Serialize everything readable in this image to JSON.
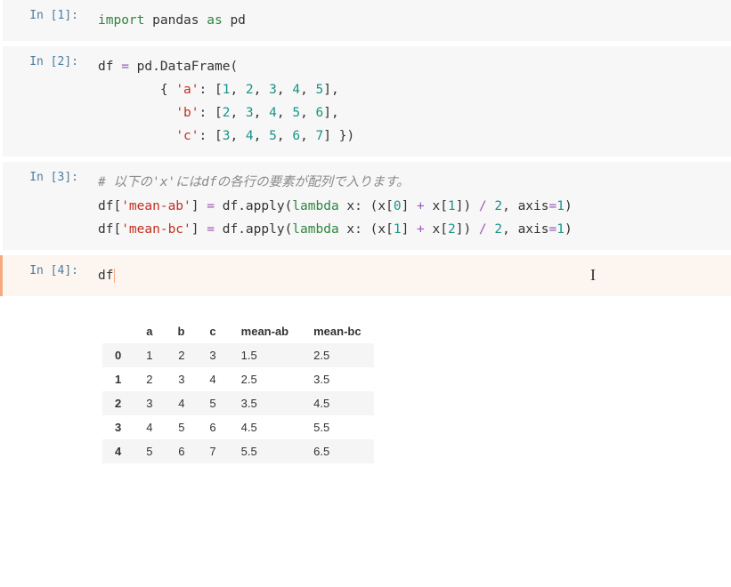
{
  "cells": {
    "c1": {
      "prompt": "In [1]:",
      "tok": {
        "import": "import",
        "pandas": "pandas",
        "as": "as",
        "pd": "pd"
      }
    },
    "c2": {
      "prompt": "In [2]:",
      "tok": {
        "df": "df",
        "eq": "=",
        "pdDataFrame": "pd.DataFrame(",
        "lbrace": "{",
        "a": "'a'",
        "colon": ":",
        "lb": "[",
        "rb": "]",
        "b": "'b'",
        "c": "'c'",
        "n1": "1",
        "n2": "2",
        "n3": "3",
        "n4": "4",
        "n5": "5",
        "n6": "6",
        "n7": "7",
        "comma": ",",
        "rbrace": "}",
        "rparen": ")"
      }
    },
    "c3": {
      "prompt": "In [3]:",
      "tok": {
        "comment_pre": "# 以下の",
        "comment_x": "'x'",
        "comment_mid": "には",
        "comment_df": "df",
        "comment_post": "の各行の要素が配列で入ります。",
        "df": "df",
        "lb": "[",
        "rb": "]",
        "meanab": "'mean-ab'",
        "meanbc": "'mean-bc'",
        "eq": "=",
        "apply": ".apply(",
        "lambda": "lambda",
        "x": "x",
        "colon": ":",
        "lp": "(",
        "rp": ")",
        "x0": "x[",
        "x1e": "]",
        "plus": "+",
        "div": "/",
        "n0": "0",
        "n1": "1",
        "n2": "2",
        "two": "2",
        "axis": "axis",
        "one": "1",
        "comma": ","
      }
    },
    "c4": {
      "prompt": "In [4]:",
      "tok": {
        "df": "df"
      }
    }
  },
  "table": {
    "columns": [
      "",
      "a",
      "b",
      "c",
      "mean-ab",
      "mean-bc"
    ],
    "rows": [
      {
        "idx": "0",
        "a": "1",
        "b": "2",
        "c": "3",
        "mab": "1.5",
        "mbc": "2.5"
      },
      {
        "idx": "1",
        "a": "2",
        "b": "3",
        "c": "4",
        "mab": "2.5",
        "mbc": "3.5"
      },
      {
        "idx": "2",
        "a": "3",
        "b": "4",
        "c": "5",
        "mab": "3.5",
        "mbc": "4.5"
      },
      {
        "idx": "3",
        "a": "4",
        "b": "5",
        "c": "6",
        "mab": "4.5",
        "mbc": "5.5"
      },
      {
        "idx": "4",
        "a": "5",
        "b": "6",
        "c": "7",
        "mab": "5.5",
        "mbc": "6.5"
      }
    ]
  },
  "chart_data": {
    "type": "table",
    "columns": [
      "a",
      "b",
      "c",
      "mean-ab",
      "mean-bc"
    ],
    "index": [
      0,
      1,
      2,
      3,
      4
    ],
    "data": [
      [
        1,
        2,
        3,
        1.5,
        2.5
      ],
      [
        2,
        3,
        4,
        2.5,
        3.5
      ],
      [
        3,
        4,
        5,
        3.5,
        4.5
      ],
      [
        4,
        5,
        6,
        4.5,
        5.5
      ],
      [
        5,
        6,
        7,
        5.5,
        6.5
      ]
    ]
  }
}
